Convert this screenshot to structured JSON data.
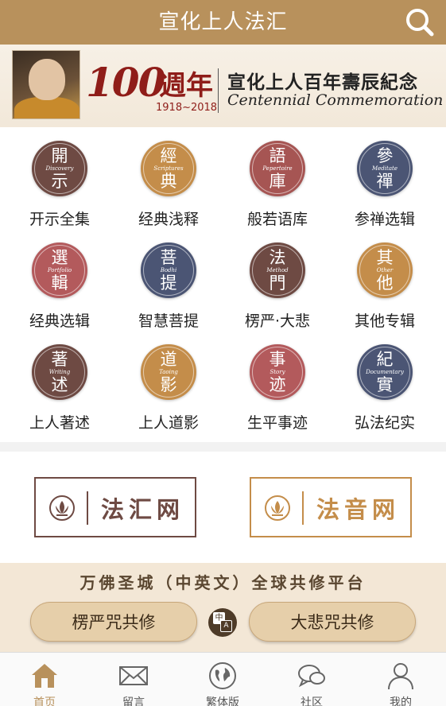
{
  "header": {
    "title": "宣化上人法汇",
    "search_icon": "search-icon"
  },
  "banner": {
    "number": "100",
    "week": "週年",
    "years": "1918~2018",
    "title_cn": "宣化上人百年壽辰紀念",
    "title_en": "Centennial Commemoration"
  },
  "grid": [
    {
      "top": "開",
      "en": "Discovery",
      "bot": "示",
      "label": "开示全集",
      "color": "#6e4a43"
    },
    {
      "top": "經",
      "en": "Scriptures",
      "bot": "典",
      "label": "经典浅释",
      "color": "#c48d4a"
    },
    {
      "top": "語",
      "en": "Pepertoire",
      "bot": "庫",
      "label": "般若语库",
      "color": "#a65553"
    },
    {
      "top": "參",
      "en": "Meditate",
      "bot": "禪",
      "label": "参禅选辑",
      "color": "#4b5574"
    },
    {
      "top": "選",
      "en": "Portfolio",
      "bot": "輯",
      "label": "经典选辑",
      "color": "#b35a5c"
    },
    {
      "top": "菩",
      "en": "Bodhi",
      "bot": "提",
      "label": "智慧菩提",
      "color": "#4b5574"
    },
    {
      "top": "法",
      "en": "Method",
      "bot": "門",
      "label": "楞严·大悲",
      "color": "#6e4a43"
    },
    {
      "top": "其",
      "en": "Other",
      "bot": "他",
      "label": "其他专辑",
      "color": "#c48d4a"
    },
    {
      "top": "著",
      "en": "Writing",
      "bot": "述",
      "label": "上人著述",
      "color": "#6e4a43"
    },
    {
      "top": "道",
      "en": "Taoing",
      "bot": "影",
      "label": "上人道影",
      "color": "#c48d4a"
    },
    {
      "top": "事",
      "en": "Story",
      "bot": "迹",
      "label": "生平事迹",
      "color": "#b35a5c"
    },
    {
      "top": "紀",
      "en": "Documentary",
      "bot": "實",
      "label": "弘法纪实",
      "color": "#4b5574"
    }
  ],
  "links": {
    "fahui": {
      "label": "法汇网",
      "color": "#6e4a43"
    },
    "fayin": {
      "label": "法音网",
      "color": "#c48d4a"
    }
  },
  "practice": {
    "title": "万佛圣城（中英文）全球共修平台",
    "left_button": "楞严咒共修",
    "right_button": "大悲咒共修",
    "toggle_cn": "中",
    "toggle_en": "A"
  },
  "tabbar": [
    {
      "label": "首页",
      "icon": "home-icon",
      "active": true
    },
    {
      "label": "留言",
      "icon": "mail-icon",
      "active": false
    },
    {
      "label": "繁体版",
      "icon": "globe-icon",
      "active": false
    },
    {
      "label": "社区",
      "icon": "chat-icon",
      "active": false
    },
    {
      "label": "我的",
      "icon": "user-icon",
      "active": false
    }
  ],
  "colors": {
    "brand": "#b8915c",
    "dark": "#6e4a43",
    "accent": "#8f1d19"
  }
}
